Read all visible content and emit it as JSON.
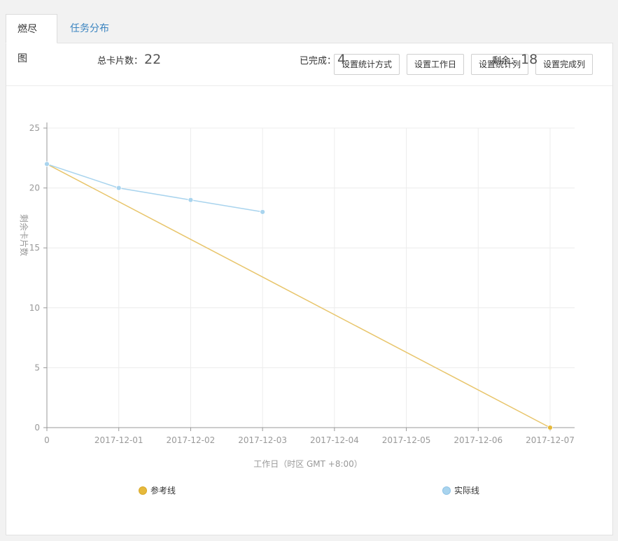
{
  "tabs": [
    {
      "label": "燃尽图",
      "active": true
    },
    {
      "label": "任务分布",
      "active": false
    }
  ],
  "toolbar": {
    "buttons": [
      "设置统计方式",
      "设置工作日",
      "设置统计列",
      "设置完成列"
    ]
  },
  "stats": {
    "total_label": "总卡片数：",
    "total_value": "22",
    "done_label": "已完成：",
    "done_value": "4",
    "remaining_label": "剩余：",
    "remaining_value": "18"
  },
  "chart_data": {
    "type": "line",
    "categories": [
      "0",
      "2017-12-01",
      "2017-12-02",
      "2017-12-03",
      "2017-12-04",
      "2017-12-05",
      "2017-12-06",
      "2017-12-07"
    ],
    "ylim": [
      0,
      25
    ],
    "yticks": [
      "0",
      "5",
      "10",
      "15",
      "20",
      "25"
    ],
    "ylabel": "剩余卡片数",
    "xlabel": "工作日（时区 GMT +8:00）",
    "grid": true,
    "series": [
      {
        "name": "参考线",
        "color": "#e8c56b",
        "marker_color": "#e6b93c",
        "values": [
          22,
          null,
          null,
          null,
          null,
          null,
          null,
          0
        ],
        "draw": "endpoints"
      },
      {
        "name": "实际线",
        "color": "#a9d4ee",
        "marker_color": "#a9d4ee",
        "values": [
          22,
          20,
          19,
          18,
          null,
          null,
          null,
          null
        ]
      }
    ],
    "legend_position": "bottom"
  }
}
